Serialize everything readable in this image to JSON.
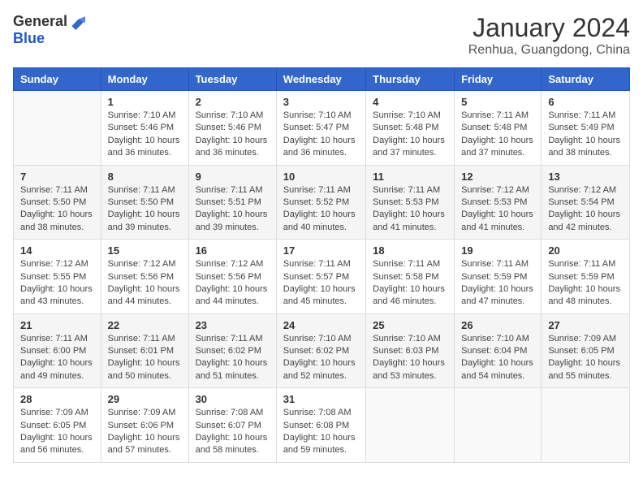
{
  "logo": {
    "general": "General",
    "blue": "Blue"
  },
  "title": "January 2024",
  "location": "Renhua, Guangdong, China",
  "days": [
    "Sunday",
    "Monday",
    "Tuesday",
    "Wednesday",
    "Thursday",
    "Friday",
    "Saturday"
  ],
  "weeks": [
    [
      {
        "date": "",
        "info": ""
      },
      {
        "date": "1",
        "info": "Sunrise: 7:10 AM\nSunset: 5:46 PM\nDaylight: 10 hours\nand 36 minutes."
      },
      {
        "date": "2",
        "info": "Sunrise: 7:10 AM\nSunset: 5:46 PM\nDaylight: 10 hours\nand 36 minutes."
      },
      {
        "date": "3",
        "info": "Sunrise: 7:10 AM\nSunset: 5:47 PM\nDaylight: 10 hours\nand 36 minutes."
      },
      {
        "date": "4",
        "info": "Sunrise: 7:10 AM\nSunset: 5:48 PM\nDaylight: 10 hours\nand 37 minutes."
      },
      {
        "date": "5",
        "info": "Sunrise: 7:11 AM\nSunset: 5:48 PM\nDaylight: 10 hours\nand 37 minutes."
      },
      {
        "date": "6",
        "info": "Sunrise: 7:11 AM\nSunset: 5:49 PM\nDaylight: 10 hours\nand 38 minutes."
      }
    ],
    [
      {
        "date": "7",
        "info": "Sunrise: 7:11 AM\nSunset: 5:50 PM\nDaylight: 10 hours\nand 38 minutes."
      },
      {
        "date": "8",
        "info": "Sunrise: 7:11 AM\nSunset: 5:50 PM\nDaylight: 10 hours\nand 39 minutes."
      },
      {
        "date": "9",
        "info": "Sunrise: 7:11 AM\nSunset: 5:51 PM\nDaylight: 10 hours\nand 39 minutes."
      },
      {
        "date": "10",
        "info": "Sunrise: 7:11 AM\nSunset: 5:52 PM\nDaylight: 10 hours\nand 40 minutes."
      },
      {
        "date": "11",
        "info": "Sunrise: 7:11 AM\nSunset: 5:53 PM\nDaylight: 10 hours\nand 41 minutes."
      },
      {
        "date": "12",
        "info": "Sunrise: 7:12 AM\nSunset: 5:53 PM\nDaylight: 10 hours\nand 41 minutes."
      },
      {
        "date": "13",
        "info": "Sunrise: 7:12 AM\nSunset: 5:54 PM\nDaylight: 10 hours\nand 42 minutes."
      }
    ],
    [
      {
        "date": "14",
        "info": "Sunrise: 7:12 AM\nSunset: 5:55 PM\nDaylight: 10 hours\nand 43 minutes."
      },
      {
        "date": "15",
        "info": "Sunrise: 7:12 AM\nSunset: 5:56 PM\nDaylight: 10 hours\nand 44 minutes."
      },
      {
        "date": "16",
        "info": "Sunrise: 7:12 AM\nSunset: 5:56 PM\nDaylight: 10 hours\nand 44 minutes."
      },
      {
        "date": "17",
        "info": "Sunrise: 7:11 AM\nSunset: 5:57 PM\nDaylight: 10 hours\nand 45 minutes."
      },
      {
        "date": "18",
        "info": "Sunrise: 7:11 AM\nSunset: 5:58 PM\nDaylight: 10 hours\nand 46 minutes."
      },
      {
        "date": "19",
        "info": "Sunrise: 7:11 AM\nSunset: 5:59 PM\nDaylight: 10 hours\nand 47 minutes."
      },
      {
        "date": "20",
        "info": "Sunrise: 7:11 AM\nSunset: 5:59 PM\nDaylight: 10 hours\nand 48 minutes."
      }
    ],
    [
      {
        "date": "21",
        "info": "Sunrise: 7:11 AM\nSunset: 6:00 PM\nDaylight: 10 hours\nand 49 minutes."
      },
      {
        "date": "22",
        "info": "Sunrise: 7:11 AM\nSunset: 6:01 PM\nDaylight: 10 hours\nand 50 minutes."
      },
      {
        "date": "23",
        "info": "Sunrise: 7:11 AM\nSunset: 6:02 PM\nDaylight: 10 hours\nand 51 minutes."
      },
      {
        "date": "24",
        "info": "Sunrise: 7:10 AM\nSunset: 6:02 PM\nDaylight: 10 hours\nand 52 minutes."
      },
      {
        "date": "25",
        "info": "Sunrise: 7:10 AM\nSunset: 6:03 PM\nDaylight: 10 hours\nand 53 minutes."
      },
      {
        "date": "26",
        "info": "Sunrise: 7:10 AM\nSunset: 6:04 PM\nDaylight: 10 hours\nand 54 minutes."
      },
      {
        "date": "27",
        "info": "Sunrise: 7:09 AM\nSunset: 6:05 PM\nDaylight: 10 hours\nand 55 minutes."
      }
    ],
    [
      {
        "date": "28",
        "info": "Sunrise: 7:09 AM\nSunset: 6:05 PM\nDaylight: 10 hours\nand 56 minutes."
      },
      {
        "date": "29",
        "info": "Sunrise: 7:09 AM\nSunset: 6:06 PM\nDaylight: 10 hours\nand 57 minutes."
      },
      {
        "date": "30",
        "info": "Sunrise: 7:08 AM\nSunset: 6:07 PM\nDaylight: 10 hours\nand 58 minutes."
      },
      {
        "date": "31",
        "info": "Sunrise: 7:08 AM\nSunset: 6:08 PM\nDaylight: 10 hours\nand 59 minutes."
      },
      {
        "date": "",
        "info": ""
      },
      {
        "date": "",
        "info": ""
      },
      {
        "date": "",
        "info": ""
      }
    ]
  ]
}
